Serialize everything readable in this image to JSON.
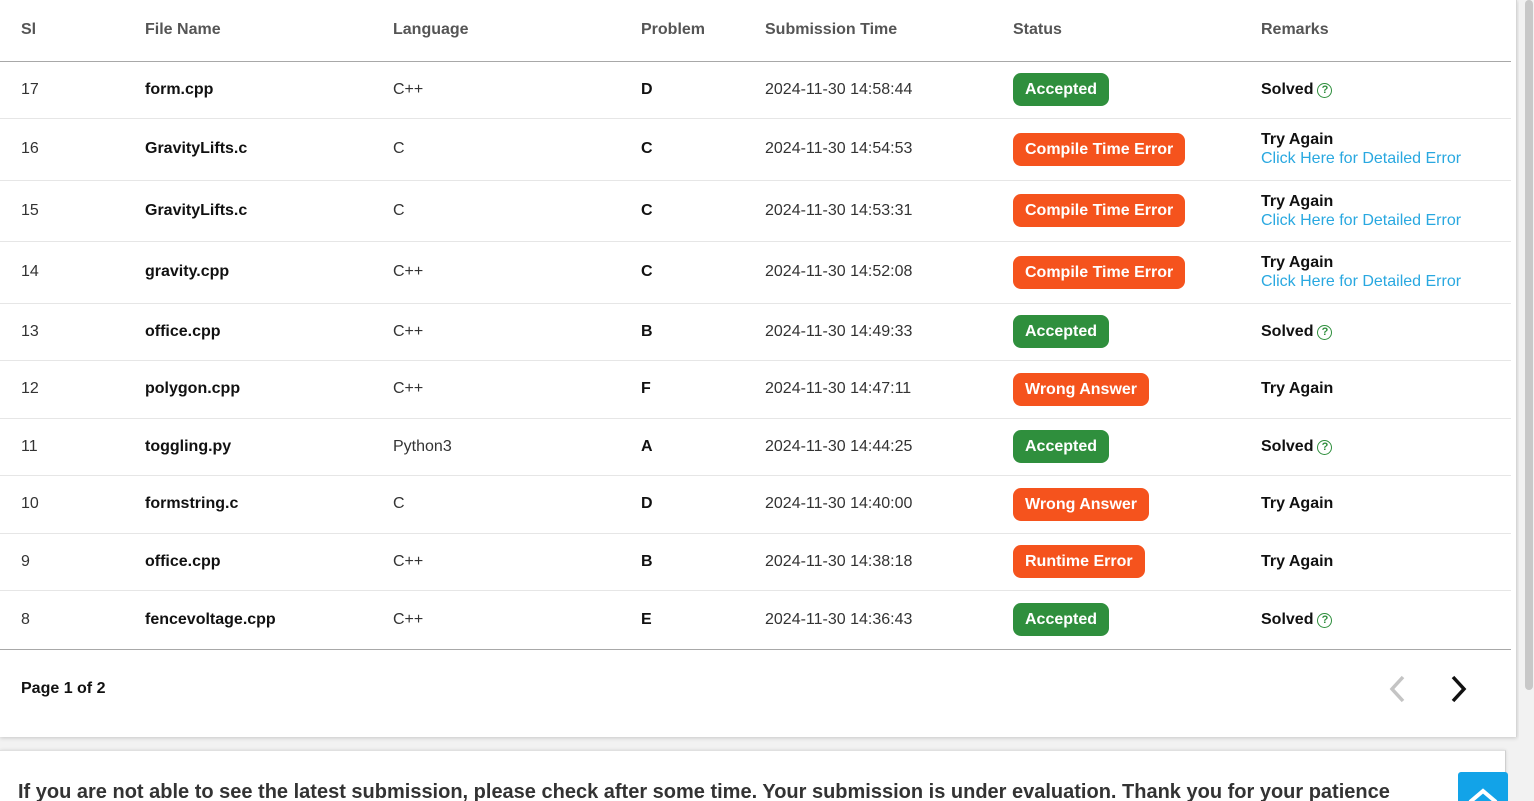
{
  "table": {
    "headers": [
      "Sl",
      "File Name",
      "Language",
      "Problem",
      "Submission Time",
      "Status",
      "Remarks"
    ],
    "rows": [
      {
        "sl": "17",
        "file": "form.cpp",
        "lang": "C++",
        "problem": "D",
        "time": "2024-11-30 14:58:44",
        "status": "Accepted",
        "status_color": "green",
        "remark": "Solved",
        "link": null
      },
      {
        "sl": "16",
        "file": "GravityLifts.c",
        "lang": "C",
        "problem": "C",
        "time": "2024-11-30 14:54:53",
        "status": "Compile Time Error",
        "status_color": "orange",
        "remark": "Try Again",
        "link": "Click Here for Detailed Error"
      },
      {
        "sl": "15",
        "file": "GravityLifts.c",
        "lang": "C",
        "problem": "C",
        "time": "2024-11-30 14:53:31",
        "status": "Compile Time Error",
        "status_color": "orange",
        "remark": "Try Again",
        "link": "Click Here for Detailed Error"
      },
      {
        "sl": "14",
        "file": "gravity.cpp",
        "lang": "C++",
        "problem": "C",
        "time": "2024-11-30 14:52:08",
        "status": "Compile Time Error",
        "status_color": "orange",
        "remark": "Try Again",
        "link": "Click Here for Detailed Error"
      },
      {
        "sl": "13",
        "file": "office.cpp",
        "lang": "C++",
        "problem": "B",
        "time": "2024-11-30 14:49:33",
        "status": "Accepted",
        "status_color": "green",
        "remark": "Solved",
        "link": null
      },
      {
        "sl": "12",
        "file": "polygon.cpp",
        "lang": "C++",
        "problem": "F",
        "time": "2024-11-30 14:47:11",
        "status": "Wrong Answer",
        "status_color": "orange",
        "remark": "Try Again",
        "link": null
      },
      {
        "sl": "11",
        "file": "toggling.py",
        "lang": "Python3",
        "problem": "A",
        "time": "2024-11-30 14:44:25",
        "status": "Accepted",
        "status_color": "green",
        "remark": "Solved",
        "link": null
      },
      {
        "sl": "10",
        "file": "formstring.c",
        "lang": "C",
        "problem": "D",
        "time": "2024-11-30 14:40:00",
        "status": "Wrong Answer",
        "status_color": "orange",
        "remark": "Try Again",
        "link": null
      },
      {
        "sl": "9",
        "file": "office.cpp",
        "lang": "C++",
        "problem": "B",
        "time": "2024-11-30 14:38:18",
        "status": "Runtime Error",
        "status_color": "orange",
        "remark": "Try Again",
        "link": null
      },
      {
        "sl": "8",
        "file": "fencevoltage.cpp",
        "lang": "C++",
        "problem": "E",
        "time": "2024-11-30 14:36:43",
        "status": "Accepted",
        "status_color": "green",
        "remark": "Solved",
        "link": null
      }
    ]
  },
  "pagination": {
    "label": "Page 1 of 2",
    "current_page": 1,
    "total_pages": 2,
    "prev_icon": "chevron-left-icon",
    "next_icon": "chevron-right-icon"
  },
  "notice": {
    "text": "If you are not able to see the latest submission, please check after some time. Your submission is under evaluation. Thank you for your patience"
  },
  "colors": {
    "accepted": "#2f8f3d",
    "error": "#f5531d",
    "link": "#29a8e0",
    "scroll_top_button": "#12a3e8"
  },
  "icons": {
    "solved_help": "help-circle-icon",
    "scroll_top": "chevron-up-icon"
  }
}
